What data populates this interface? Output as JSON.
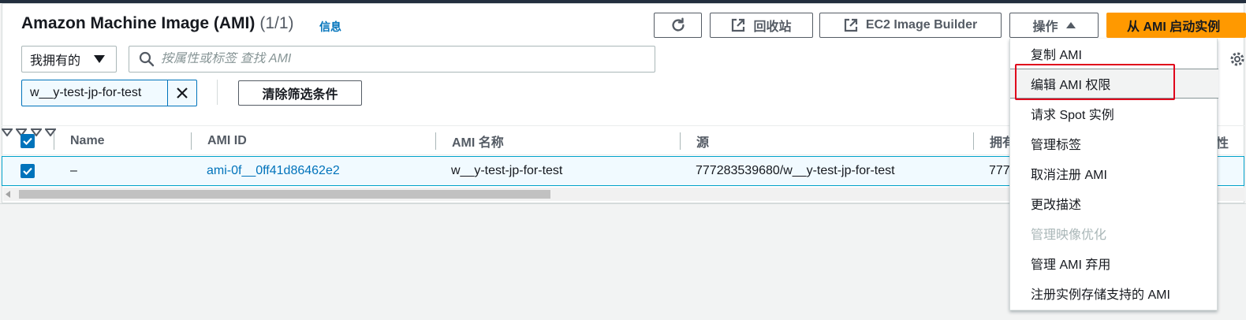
{
  "header": {
    "title": "Amazon Machine Image (AMI)",
    "count": "(1/1)",
    "info_link": "信息"
  },
  "toolbar": {
    "refresh_icon": "refresh-icon",
    "recycle_bin_label": "回收站",
    "image_builder_label": "EC2 Image Builder",
    "actions_label": "操作",
    "launch_label": "从 AMI 启动实例",
    "external_icon": "external-link-icon"
  },
  "filter": {
    "ownership_selected": "我拥有的",
    "search_placeholder": "按属性或标签 查找 AMI",
    "token_value": "w__y-test-jp-for-test",
    "clear_filters_label": "清除筛选条件"
  },
  "table": {
    "columns": [
      "Name",
      "AMI ID",
      "AMI 名称",
      "源",
      "拥有"
    ],
    "partial_column": "性",
    "rows": [
      {
        "name": "–",
        "ami_id": "ami-0f__0ff41d86462e2",
        "ami_name": "w__y-test-jp-for-test",
        "source": "777283539680/w__y-test-jp-for-test",
        "owner": "777"
      }
    ]
  },
  "actions_menu": {
    "items": [
      {
        "label": "复制 AMI",
        "disabled": false
      },
      {
        "label": "编辑 AMI 权限",
        "disabled": false,
        "highlighted": true
      },
      {
        "label": "请求 Spot 实例",
        "disabled": false
      },
      {
        "label": "管理标签",
        "disabled": false
      },
      {
        "label": "取消注册 AMI",
        "disabled": false
      },
      {
        "label": "更改描述",
        "disabled": false
      },
      {
        "label": "管理映像优化",
        "disabled": true
      },
      {
        "label": "管理 AMI 弃用",
        "disabled": false
      },
      {
        "label": "注册实例存储支持的 AMI",
        "disabled": false
      }
    ]
  },
  "colors": {
    "accent": "#0073bb",
    "primary_button": "#ff9900",
    "highlight_border": "#e0001b"
  }
}
